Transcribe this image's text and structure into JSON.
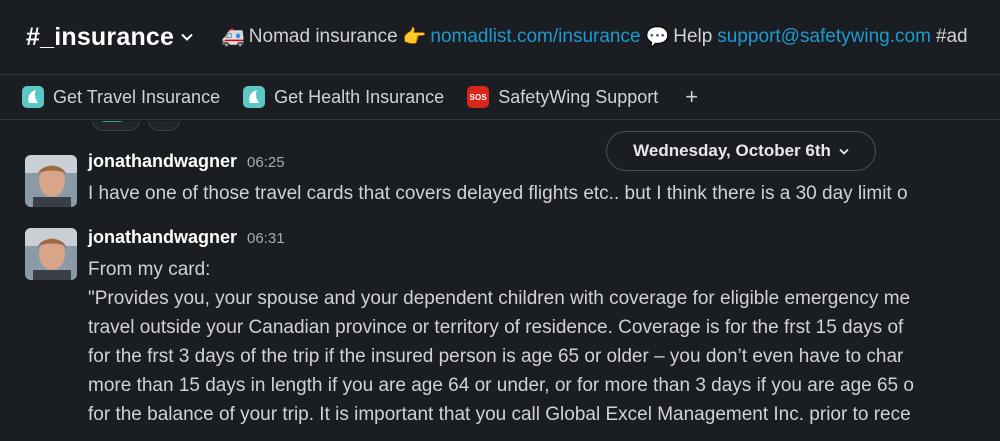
{
  "header": {
    "channel_prefix": "# ",
    "channel_name": "_insurance",
    "topic": {
      "emoji_1": "🚑",
      "text_1": "Nomad insurance",
      "emoji_2": "👉",
      "link_1": "nomadlist.com/insurance",
      "emoji_3": "💬",
      "text_2": "Help",
      "link_2": "support@safetywing.com",
      "text_3": "#ad"
    }
  },
  "bookmarks": [
    {
      "label": "Get Travel Insurance",
      "icon": "safetywing-logo-icon"
    },
    {
      "label": "Get Health Insurance",
      "icon": "safetywing-logo-icon"
    },
    {
      "label": "SafetyWing Support",
      "icon": "sos-icon",
      "icon_text": "SOS"
    }
  ],
  "bookmark_add": "+",
  "date_divider": "Wednesday, October 6th",
  "messages": [
    {
      "author": "jonathandwagner",
      "time": "06:25",
      "lines": [
        "I have one of those travel cards that covers delayed flights etc.. but I think there is a 30 day limit o"
      ]
    },
    {
      "author": "jonathandwagner",
      "time": "06:31",
      "lines": [
        "From my card:",
        "\"Provides you, your spouse and your dependent children with coverage for eligible emergency me",
        "travel outside your Canadian province or territory of residence. Coverage is for the frst 15 days of",
        "for the frst 3 days of the trip if the insured person is age 65 or older – you don’t even have to char",
        "more than 15 days in length if you are age 64 or under, or for more than 3 days if you are age 65 o",
        "for the balance of your trip. It is important that you call Global Excel Management Inc. prior to rece"
      ]
    }
  ],
  "colors": {
    "background": "#1a1d21",
    "link": "#1d9bd1",
    "text": "#d1d2d3",
    "author": "#ffffff",
    "timestamp": "#ababad",
    "sos_red": "#d9261c",
    "safetywing_teal": "#5cc7c4"
  }
}
